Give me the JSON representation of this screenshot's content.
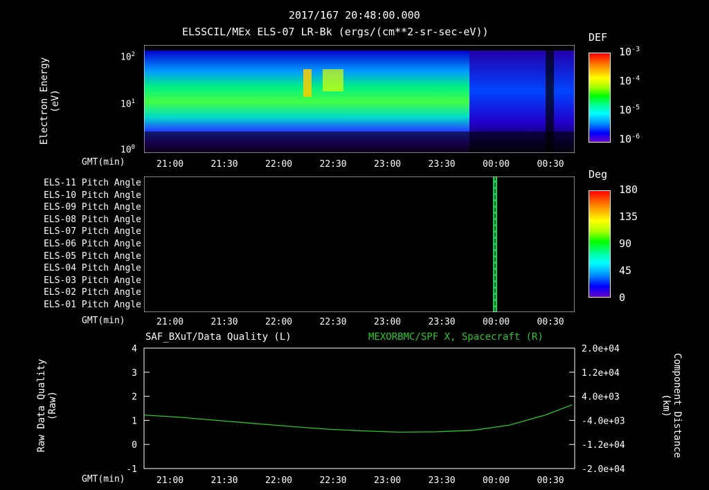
{
  "header": {
    "line1": "2017/167  20:48:00.000",
    "line2": "ELSSCIL/MEx ELS-07 LR-Bk  (ergs/(cm**2-sr-sec-eV))"
  },
  "time_axis": {
    "label": "GMT(min)",
    "ticks": [
      "21:00",
      "21:30",
      "22:00",
      "22:30",
      "23:00",
      "23:30",
      "00:00",
      "00:30"
    ]
  },
  "panel1": {
    "ylabel_line1": "Electron Energy",
    "ylabel_line2": "(eV)",
    "yticks": [
      {
        "base": "10",
        "exp": "2"
      },
      {
        "base": "10",
        "exp": "1"
      },
      {
        "base": "10",
        "exp": "0"
      }
    ],
    "colorbar_title": "DEF",
    "colorbar_ticks": [
      {
        "base": "10",
        "exp": "-3"
      },
      {
        "base": "10",
        "exp": "-4"
      },
      {
        "base": "10",
        "exp": "-5"
      },
      {
        "base": "10",
        "exp": "-6"
      }
    ]
  },
  "panel2": {
    "labels": [
      "ELS-11 Pitch Angle",
      "ELS-10 Pitch Angle",
      "ELS-09 Pitch Angle",
      "ELS-08 Pitch Angle",
      "ELS-07 Pitch Angle",
      "ELS-06 Pitch Angle",
      "ELS-05 Pitch Angle",
      "ELS-04 Pitch Angle",
      "ELS-03 Pitch Angle",
      "ELS-02 Pitch Angle",
      "ELS-01 Pitch Angle"
    ],
    "colorbar_title": "Deg",
    "colorbar_ticks": [
      "180",
      "135",
      "90",
      "45",
      "0"
    ]
  },
  "panel3": {
    "title_left": "SAF_BXuT/Data Quality (L)",
    "title_right": "MEXORBMC/SPF X, Spacecraft (R)",
    "ylabel_left_line1": "Raw Data Quality",
    "ylabel_left_line2": "(Raw)",
    "ylabel_right_line1": "Component Distance",
    "ylabel_right_line2": "(km)",
    "left_ticks": [
      "4",
      "3",
      "2",
      "1",
      "0",
      "-1"
    ],
    "right_ticks": [
      "2.0e+04",
      "1.2e+04",
      "4.0e+03",
      "-4.0e+03",
      "-1.2e+04",
      "-2.0e+04"
    ],
    "line_color": "#22cc22"
  },
  "chart_data": [
    {
      "type": "heatmap",
      "title": "ELSSCIL/MEx ELS-07 LR-Bk  (ergs/(cm**2-sr-sec-eV))",
      "xlabel": "GMT(min)",
      "ylabel": "Electron Energy (eV)",
      "y_scale": "log",
      "ylim": [
        1,
        150
      ],
      "colorbar": {
        "label": "DEF",
        "range": [
          1e-06,
          0.001
        ],
        "scale": "log"
      },
      "x_ticks": [
        "21:00",
        "21:30",
        "22:00",
        "22:30",
        "23:00",
        "23:30",
        "00:00",
        "00:30"
      ]
    },
    {
      "type": "heatmap",
      "xlabel": "GMT(min)",
      "categories": [
        "ELS-11",
        "ELS-10",
        "ELS-09",
        "ELS-08",
        "ELS-07",
        "ELS-06",
        "ELS-05",
        "ELS-04",
        "ELS-03",
        "ELS-02",
        "ELS-01"
      ],
      "colorbar": {
        "label": "Deg",
        "range": [
          0,
          180
        ]
      },
      "x_ticks": [
        "21:00",
        "21:30",
        "22:00",
        "22:30",
        "23:00",
        "23:30",
        "00:00",
        "00:30"
      ]
    },
    {
      "type": "line",
      "title_left": "SAF_BXuT/Data Quality (L)",
      "title_right": "MEXORBMC/SPF X, Spacecraft (R)",
      "xlabel": "GMT(min)",
      "ylim_left": [
        -1,
        4
      ],
      "ylim_right": [
        -20000,
        20000
      ],
      "x_ticks": [
        "21:00",
        "21:30",
        "22:00",
        "22:30",
        "23:00",
        "23:30",
        "00:00",
        "00:30"
      ],
      "series": [
        {
          "name": "MEXORBMC/SPF X, Spacecraft (R)",
          "axis": "right",
          "x_minutes_since_2048": [
            0,
            30,
            60,
            90,
            120,
            150,
            180,
            210,
            240,
            270,
            300,
            330,
            352
          ],
          "y_km": [
            -2200,
            -3000,
            -4000,
            -5000,
            -6000,
            -6900,
            -7500,
            -7900,
            -7800,
            -7300,
            -5600,
            -2200,
            1200
          ]
        }
      ]
    }
  ]
}
